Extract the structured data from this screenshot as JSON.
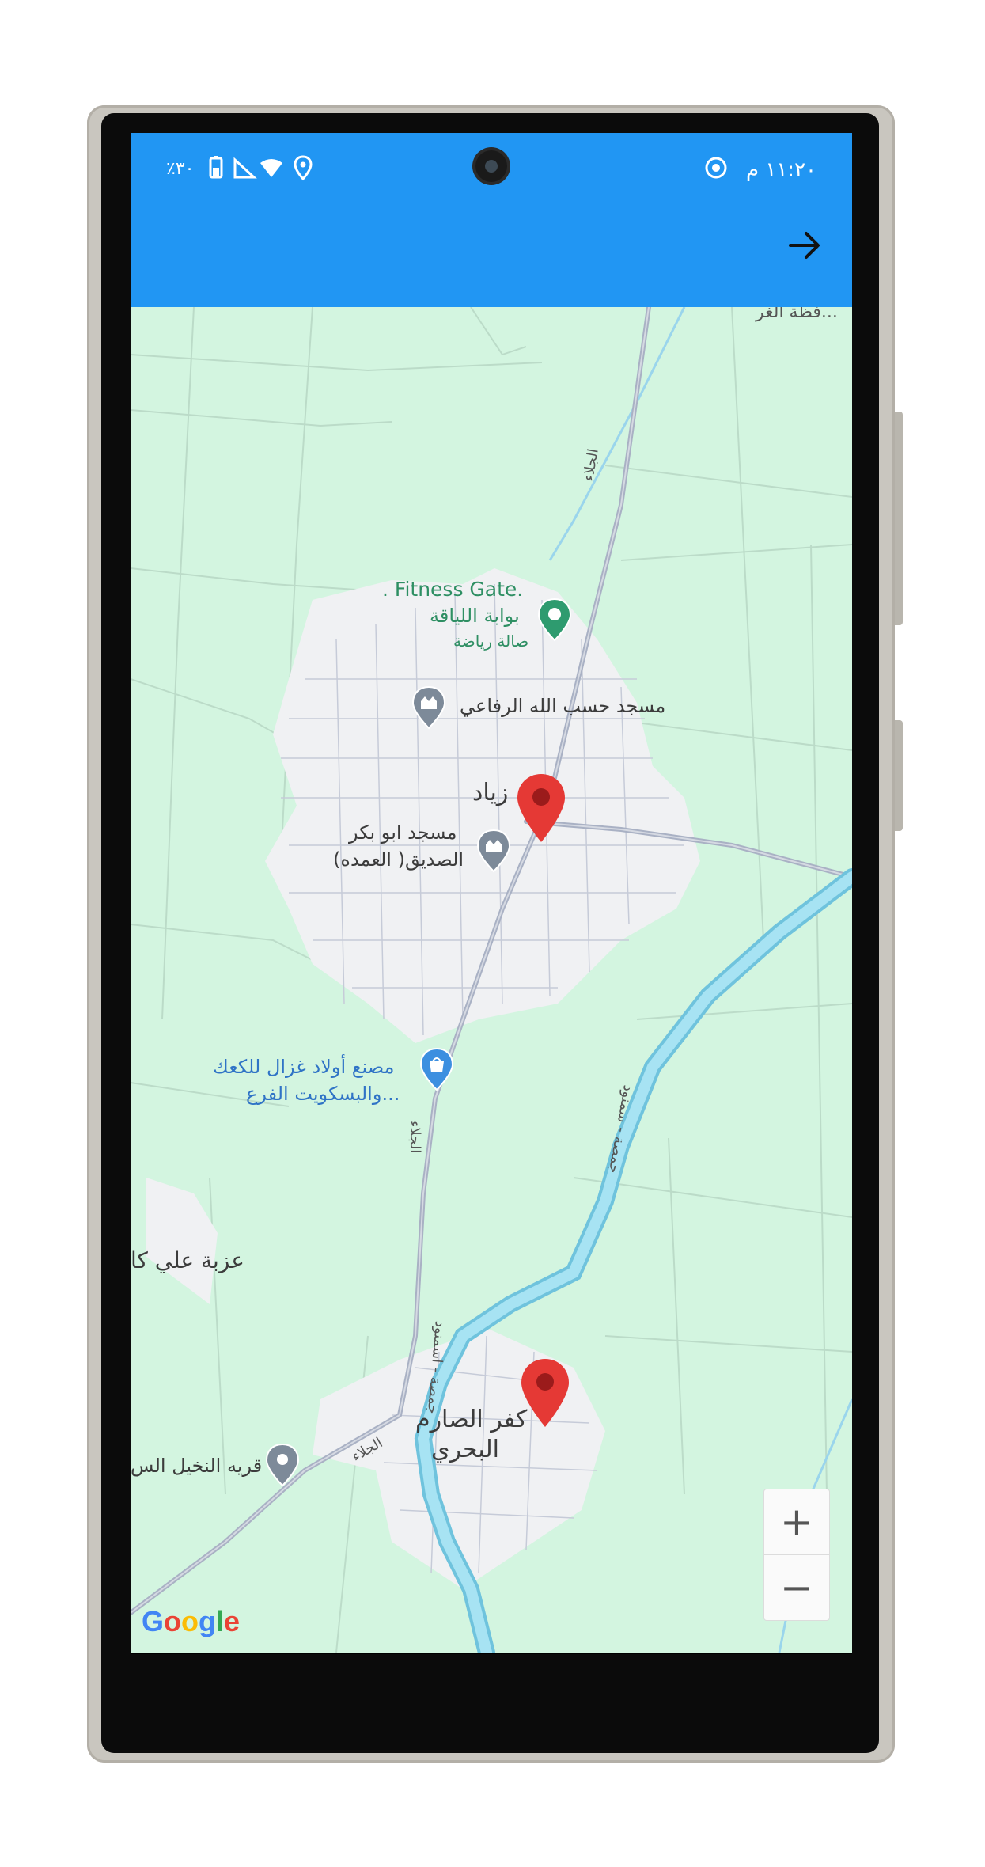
{
  "status_bar": {
    "time": "١١:٢٠ م",
    "battery": "٪٣٠"
  },
  "app_bar": {
    "back_icon": "arrow-right-icon"
  },
  "map": {
    "labels": {
      "fitness_en": ". Fitness Gate.",
      "fitness_ar": "بوابة اللياقة",
      "fitness_cat": "صالة رياضة",
      "mosque1": "مسجد حسب الله الرفاعي",
      "town1": "زياد",
      "mosque2_l1": "مسجد ابو بكر",
      "mosque2_l2": "الصديق( العمده)",
      "factory_l1": "مصنع أولاد غزال للكعك",
      "factory_l2": "والبسكويت الفرع...",
      "road1": "الجلاء",
      "road2": "الجلاء",
      "road3": "الجلاء",
      "canal1": "جمصة - سمنود",
      "canal2": "جمصة - اسمنود",
      "village1": "عزبة علي كا",
      "town2_l1": "كفر الصارم",
      "town2_l2": "البحري",
      "place3": "قريه النخيل الس",
      "top_edge": "فظة الغر..."
    },
    "zoom_in": "+",
    "zoom_out": "−",
    "google_logo": {
      "letters": [
        "G",
        "o",
        "o",
        "g",
        "l",
        "e"
      ],
      "colors": [
        "#4285f4",
        "#ea4335",
        "#fbbc05",
        "#4285f4",
        "#34a853",
        "#ea4335"
      ]
    }
  },
  "colors": {
    "primary": "#2196f3",
    "map_bg": "#d3f5e0",
    "pin": "#e53935",
    "water": "#7fd6ee"
  }
}
